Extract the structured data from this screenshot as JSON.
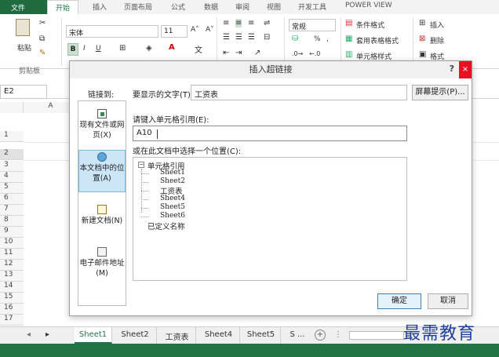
{
  "ribbon": {
    "tabs": [
      "文件",
      "开始",
      "插入",
      "页面布局",
      "公式",
      "数据",
      "审阅",
      "视图",
      "开发工具",
      "POWER VIEW"
    ],
    "paste_label": "粘贴",
    "clipboard_group": "剪贴板",
    "font_name": "宋体",
    "font_size": "11",
    "grow_font": "A˄",
    "shrink_font": "A˅",
    "bold": "B",
    "italic": "I",
    "underline": "U",
    "number_format": "常规",
    "percent": "%",
    "comma": ",",
    "conditional_format": "条件格式",
    "format_as_table": "套用表格格式",
    "cell_styles": "单元格样式",
    "insert": "插入",
    "delete": "删除",
    "format": "格式"
  },
  "formula_bar": {
    "name_box": "E2"
  },
  "grid": {
    "columns": [
      "A"
    ],
    "rows": [
      "1",
      "2",
      "3",
      "4",
      "5",
      "6",
      "7",
      "8",
      "9",
      "10",
      "11",
      "12",
      "13",
      "14",
      "15",
      "16",
      "17"
    ]
  },
  "sheet_tabs": {
    "tabs": [
      "Sheet1",
      "Sheet2",
      "工资表",
      "Sheet4",
      "Sheet5",
      "S ..."
    ],
    "active": "Sheet1"
  },
  "dialog": {
    "title": "插入超链接",
    "help": "?",
    "close": "×",
    "link_to_label": "链接到:",
    "nav": [
      {
        "line1": "现有文件或网",
        "line2": "页(X)"
      },
      {
        "line1": "本文档中的位",
        "line2": "置(A)"
      },
      {
        "line1": "新建文档(N)",
        "line2": ""
      },
      {
        "line1": "电子邮件地址",
        "line2": "(M)"
      }
    ],
    "display_text_label": "要显示的文字(T):",
    "display_text_value": "工资表",
    "screen_tip_button": "屏幕提示(P)...",
    "cell_ref_label": "请键入单元格引用(E):",
    "cell_ref_value": "A10",
    "place_label": "或在此文档中选择一个位置(C):",
    "tree": {
      "root": "单元格引用",
      "children": [
        "Sheet1",
        "Sheet2",
        "工资表",
        "Sheet4",
        "Sheet5",
        "Sheet6"
      ],
      "defined_names": "已定义名称"
    },
    "ok_button": "确定",
    "cancel_button": "取消"
  },
  "watermark": "最需教育",
  "colors": {
    "excel_green": "#217346",
    "selection_blue": "#cde6f7",
    "close_red": "#e81123",
    "watermark_blue": "#1f3f9c"
  }
}
